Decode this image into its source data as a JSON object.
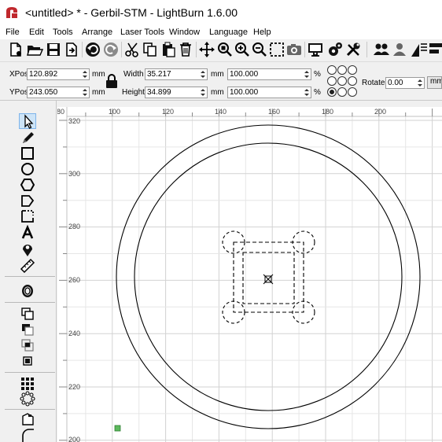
{
  "window": {
    "title": "<untitled> * - Gerbil-STM - LightBurn 1.6.00",
    "logo_icon": "lightburn-logo-icon"
  },
  "menu": [
    {
      "label": "File"
    },
    {
      "label": "Edit"
    },
    {
      "label": "Tools"
    },
    {
      "label": "Arrange"
    },
    {
      "label": "Laser Tools"
    },
    {
      "label": "Window"
    },
    {
      "label": "Language"
    },
    {
      "label": "Help"
    }
  ],
  "toolbar": [
    "new-file-icon",
    "open-folder-icon",
    "save-icon",
    "import-icon",
    "undo-icon",
    "redo-icon",
    "cut-icon",
    "copy-icon",
    "paste-icon",
    "delete-icon",
    "move-icon",
    "zoom-selection-icon",
    "zoom-in-icon",
    "zoom-out-icon",
    "frame-selection-icon",
    "camera-icon",
    "monitor-icon",
    "settings-gear-icon",
    "tools-icon",
    "users-icon",
    "user-icon",
    "arrange-icon"
  ],
  "editbar": {
    "xpos": {
      "label": "XPos",
      "value": "120.892",
      "unit": "mm"
    },
    "ypos": {
      "label": "YPos",
      "value": "243.050",
      "unit": "mm"
    },
    "width": {
      "label": "Width",
      "value": "35.217",
      "unit": "mm",
      "percent": "100.000",
      "percent_unit": "%"
    },
    "height": {
      "label": "Height",
      "value": "34.899",
      "unit": "mm",
      "percent": "100.000",
      "percent_unit": "%"
    },
    "rotate": {
      "label": "Rotate",
      "value": "0.00"
    },
    "more_label": "mm",
    "lock_icon": "lock-icon"
  },
  "palette": [
    "select-arrow-icon",
    "pen-icon",
    "rectangle-icon",
    "ellipse-icon",
    "polygon-icon",
    "edit-nodes-icon",
    "position-laser-icon",
    "text-icon",
    "location-pin-icon",
    "measure-icon",
    "offset-shapes-icon",
    "boolean-union-icon",
    "boolean-difference-icon",
    "boolean-intersection-icon",
    "weld-icon",
    "grid-array-icon",
    "circular-array-icon",
    "tab-tool-icon",
    "corner-tool-icon"
  ],
  "canvas": {
    "x_ticks": [
      "80",
      "100",
      "120",
      "140",
      "160",
      "180",
      "200"
    ],
    "y_ticks": [
      "320",
      "300",
      "280",
      "260",
      "240",
      "220",
      "200"
    ],
    "colors": {
      "grid_minor": "#e6e6e6",
      "grid_major": "#d2d2d2",
      "shape_stroke": "#000000",
      "origin_marker": "#5cb85c"
    }
  }
}
